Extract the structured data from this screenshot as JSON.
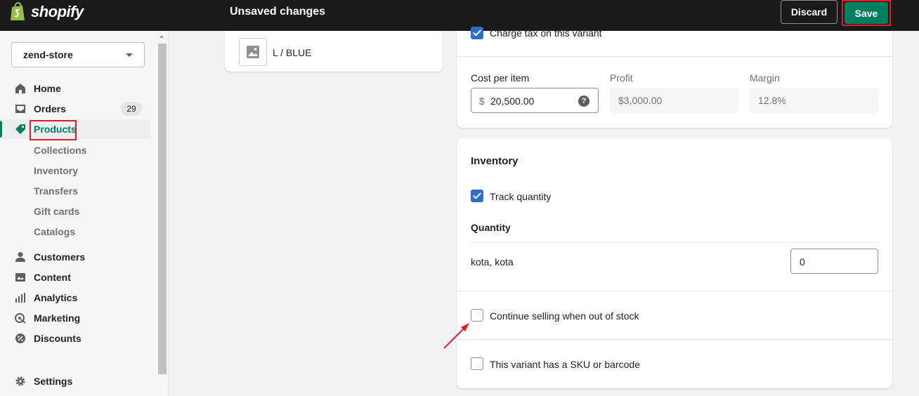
{
  "topbar": {
    "brand": "shopify",
    "title": "Unsaved changes",
    "discard_label": "Discard",
    "save_label": "Save"
  },
  "sidebar": {
    "store": "zend-store",
    "nav": [
      {
        "label": "Home",
        "icon": "home-icon"
      },
      {
        "label": "Orders",
        "icon": "inbox-icon",
        "badge": "29"
      },
      {
        "label": "Products",
        "icon": "tag-icon",
        "active": true
      },
      {
        "label": "Customers",
        "icon": "person-icon"
      },
      {
        "label": "Content",
        "icon": "image-icon"
      },
      {
        "label": "Analytics",
        "icon": "bar-chart-icon"
      },
      {
        "label": "Marketing",
        "icon": "target-icon"
      },
      {
        "label": "Discounts",
        "icon": "discount-icon"
      }
    ],
    "products_sub": [
      "Collections",
      "Inventory",
      "Transfers",
      "Gift cards",
      "Catalogs"
    ],
    "settings": {
      "label": "Settings",
      "icon": "gear-icon"
    }
  },
  "variant_list": {
    "item": "L / BLUE"
  },
  "pricing": {
    "charge_tax_label": "Charge tax on this variant",
    "cost_label": "Cost per item",
    "currency_symbol": "$",
    "cost_value": "20,500.00",
    "profit_label": "Profit",
    "profit_value": "$3,000.00",
    "margin_label": "Margin",
    "margin_value": "12.8%"
  },
  "inventory": {
    "title": "Inventory",
    "track_quantity_label": "Track quantity",
    "track_quantity_checked": true,
    "quantity_heading": "Quantity",
    "location": "kota, kota",
    "quantity_value": "0",
    "continue_selling_label": "Continue selling when out of stock",
    "continue_selling_checked": false,
    "sku_label": "This variant has a SKU or barcode",
    "sku_checked": false
  },
  "colors": {
    "accent": "#008060",
    "highlight": "#e11d28",
    "checkbox": "#2c6ecb"
  }
}
